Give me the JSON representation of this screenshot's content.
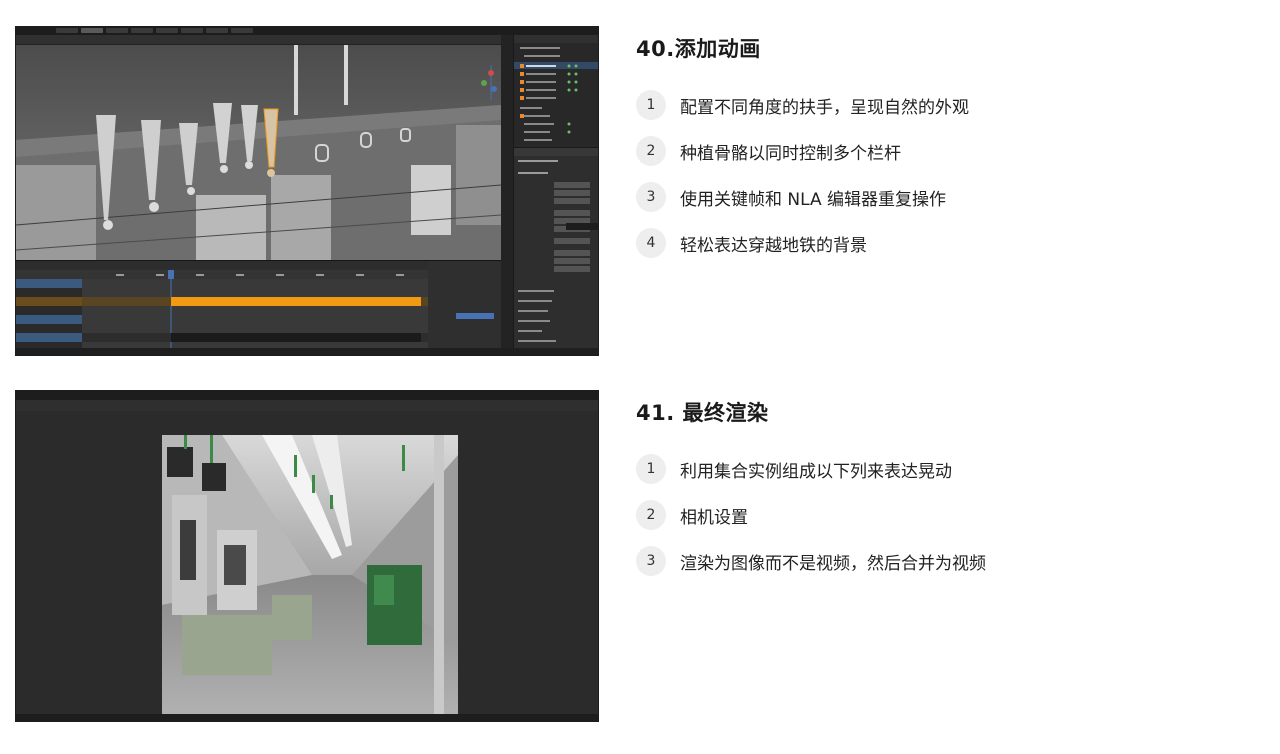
{
  "sections": [
    {
      "heading": "40.添加动画",
      "screenshot_icon": "blender-animation-screenshot",
      "steps": [
        {
          "num": "1",
          "text": "配置不同角度的扶手，呈现自然的外观"
        },
        {
          "num": "2",
          "text": "种植骨骼以同时控制多个栏杆"
        },
        {
          "num": "3",
          "text": "使用关键帧和 NLA 编辑器重复操作"
        },
        {
          "num": "4",
          "text": "轻松表达穿越地铁的背景"
        }
      ]
    },
    {
      "heading": "41. 最终渲染",
      "screenshot_icon": "blender-render-screenshot",
      "steps": [
        {
          "num": "1",
          "text": "利用集合实例组成以下列来表达晃动"
        },
        {
          "num": "2",
          "text": "相机设置"
        },
        {
          "num": "3",
          "text": "渲染为图像而不是视频，然后合并为视频"
        }
      ]
    }
  ],
  "colors": {
    "nla_strip_active": "#f29b12",
    "nla_strip_dark": "#1b1b1b",
    "selection_blue": "#4772b3",
    "subway_green": "#2f6b3b"
  }
}
